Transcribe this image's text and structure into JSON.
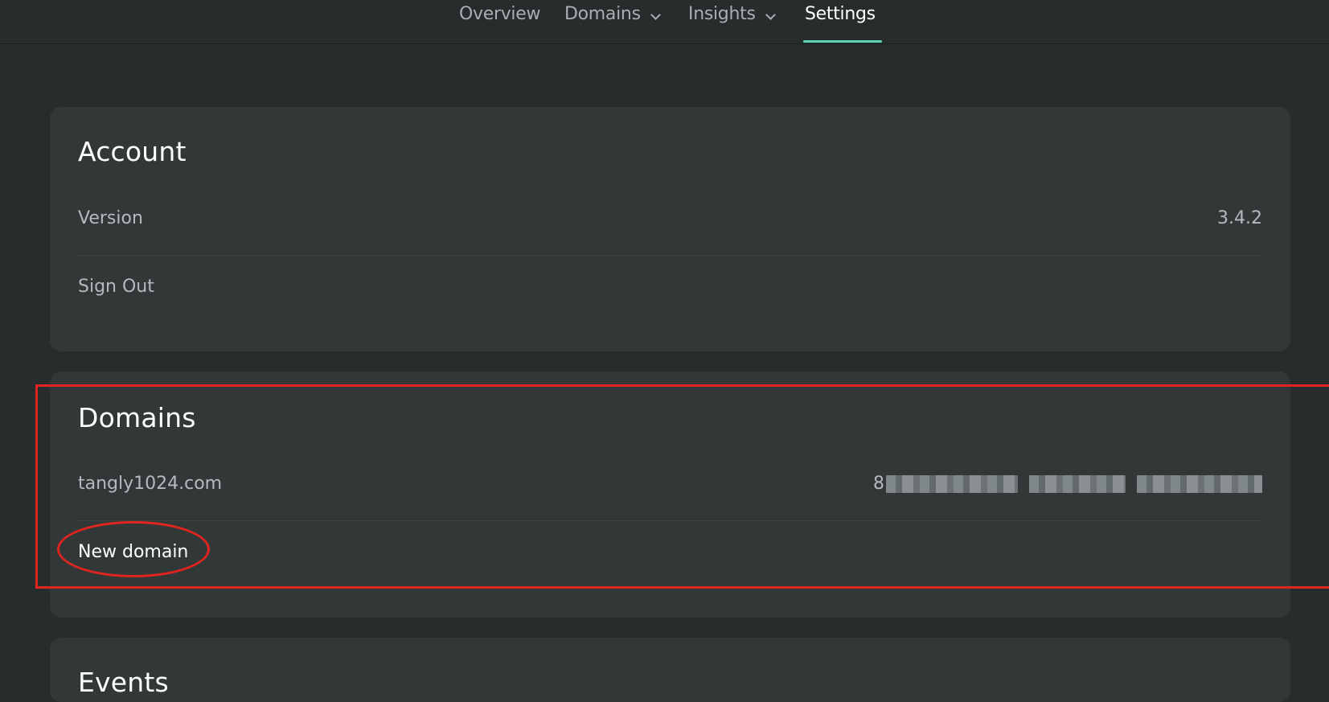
{
  "nav": {
    "items": [
      {
        "label": "Overview",
        "has_dropdown": false,
        "active": false
      },
      {
        "label": "Domains",
        "has_dropdown": true,
        "active": false
      },
      {
        "label": "Insights",
        "has_dropdown": true,
        "active": false
      },
      {
        "label": "Settings",
        "has_dropdown": false,
        "active": true
      }
    ],
    "accent_color": "#5fd3b5"
  },
  "account": {
    "title": "Account",
    "version_label": "Version",
    "version_value": "3.4.2",
    "sign_out_label": "Sign Out"
  },
  "domains": {
    "title": "Domains",
    "items": [
      {
        "name": "tangly1024.com",
        "id_visible_prefix": "8"
      }
    ],
    "new_domain_label": "New domain"
  },
  "next_section": {
    "title": "Events"
  },
  "annotation_color": "#e0241f"
}
